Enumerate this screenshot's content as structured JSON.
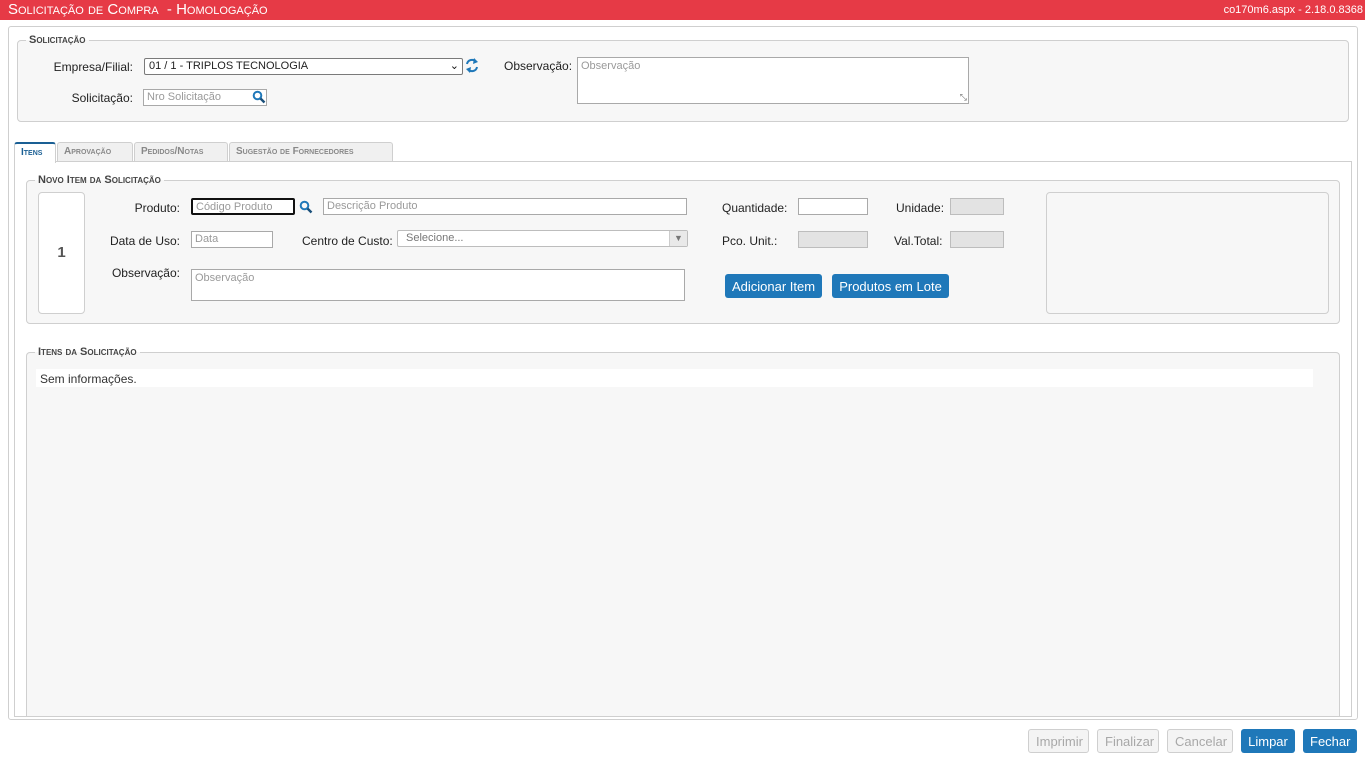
{
  "window": {
    "title": "Solicitação de Compra  - Homologação",
    "version": "co170m6.aspx - 2.18.0.8368"
  },
  "solicitacao": {
    "legend": "Solicitação",
    "empresa_label": "Empresa/Filial:",
    "empresa_value": "01 / 1 - TRIPLOS TECNOLOGIA",
    "solicitacao_label": "Solicitação:",
    "solicitacao_placeholder": "Nro Solicitação",
    "observacao_label": "Observação:",
    "observacao_placeholder": "Observação"
  },
  "tabs": [
    "Itens",
    "Aprovação",
    "Pedidos/Notas",
    "Sugestão de Fornecedores"
  ],
  "novo_item": {
    "legend": "Novo Item da Solicitação",
    "item_number": "1",
    "produto_label": "Produto:",
    "codigo_placeholder": "Código Produto",
    "descricao_placeholder": "Descrição Produto",
    "quantidade_label": "Quantidade:",
    "unidade_label": "Unidade:",
    "data_uso_label": "Data de Uso:",
    "data_placeholder": "Data",
    "centro_custo_label": "Centro de Custo:",
    "centro_custo_value": "Selecione...",
    "pco_unit_label": "Pco. Unit.:",
    "val_total_label": "Val.Total:",
    "observacao_label": "Observação:",
    "observacao_placeholder": "Observação",
    "adicionar_button": "Adicionar Item",
    "lote_button": "Produtos em Lote"
  },
  "itens": {
    "legend": "Itens da Solicitação",
    "empty_text": "Sem informações."
  },
  "footer": {
    "imprimir": "Imprimir",
    "finalizar": "Finalizar",
    "cancelar": "Cancelar",
    "limpar": "Limpar",
    "fechar": "Fechar"
  },
  "colors": {
    "titlebar": "#e63a46",
    "primary_button": "#1f78b9",
    "active_tab": "#1a5f94"
  }
}
